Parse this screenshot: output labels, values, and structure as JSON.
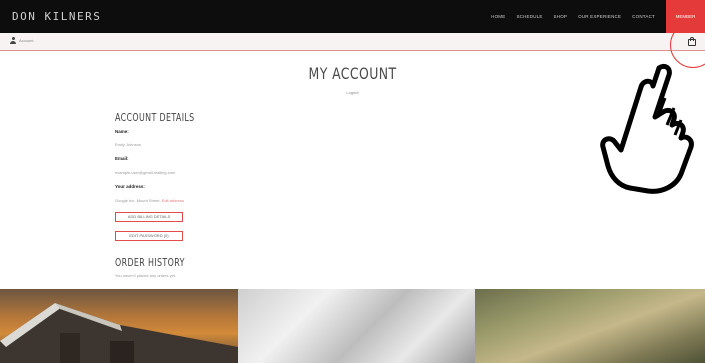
{
  "header": {
    "brand": "DON KILNERS",
    "nav": [
      "HOME",
      "SCHEDULE",
      "SHOP",
      "OUR EXPERIENCE",
      "CONTACT"
    ],
    "cta": "MEMBER"
  },
  "subbar": {
    "user_label": "Account"
  },
  "page": {
    "title": "MY ACCOUNT",
    "logout": "Logout"
  },
  "account": {
    "section_title": "ACCOUNT DETAILS",
    "name_label": "Name:",
    "name_value": "Emily Johnson",
    "email_label": "Email:",
    "email_value": "example.user@gmail-mailing.com",
    "address_label": "Your address:",
    "address_value": "Google Inc. Mount Street, ",
    "address_link": "Edit address",
    "btn_address": "ADD BILLING DETAILS",
    "btn_password": "EDIT PASSWORD (0)"
  },
  "orders": {
    "section_title": "ORDER HISTORY",
    "empty_text": "You haven't placed any orders yet."
  },
  "icons": {
    "user": "user-icon",
    "cart": "shopping-bag-icon",
    "hand": "pointing-hand-icon"
  },
  "colors": {
    "accent": "#e53a3a",
    "topbar": "#0d0d0d"
  }
}
